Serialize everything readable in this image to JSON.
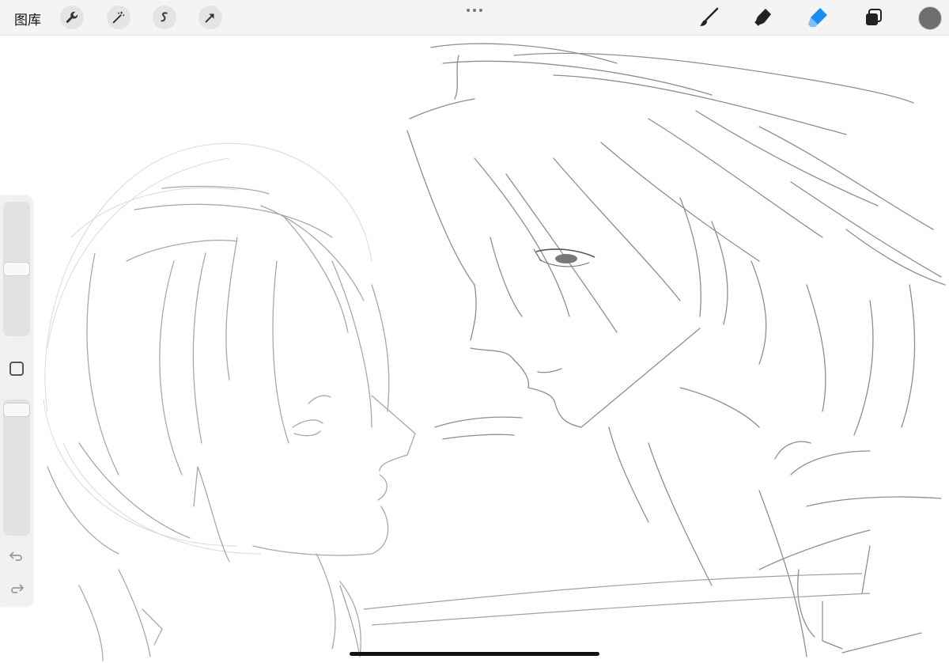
{
  "app": {
    "gallery_label": "图库"
  },
  "toolbar": {
    "left_tools": [
      "wrench-icon",
      "magic-wand-icon",
      "selection-icon",
      "move-arrow-icon"
    ],
    "right_tools": [
      "brush-icon",
      "smudge-icon",
      "eraser-icon",
      "layers-icon"
    ],
    "active_tool": "eraser",
    "accent_color": "#1f8cf0",
    "current_color": "#6f6f6f"
  },
  "sidebar": {
    "brush_size_level": 0.82,
    "opacity_level": 0.97,
    "controls": [
      "size-slider",
      "modifier-square",
      "opacity-slider",
      "undo-icon",
      "redo-icon"
    ]
  },
  "canvas": {
    "background": "#ffffff",
    "stroke_color": "#9a9a9a"
  }
}
